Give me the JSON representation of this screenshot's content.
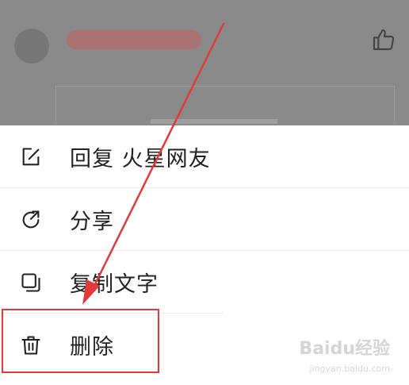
{
  "menu": {
    "items": [
      {
        "label": "回复 火星网友",
        "icon": "reply-edit-icon"
      },
      {
        "label": "分享",
        "icon": "share-icon"
      },
      {
        "label": "复制文字",
        "icon": "copy-icon"
      },
      {
        "label": "删除",
        "icon": "trash-icon"
      }
    ]
  },
  "colors": {
    "overlay": "#8a8a8a",
    "annotation": "#e23a3a",
    "text": "#222222"
  },
  "watermark": {
    "brand": "Baidu经验",
    "url": "jingyan.baidu.com"
  }
}
